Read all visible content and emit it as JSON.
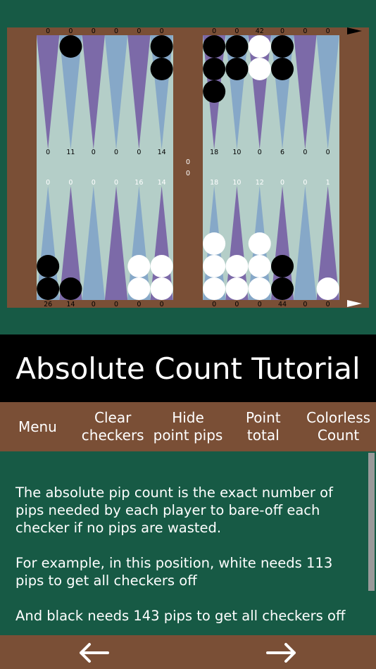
{
  "board": {
    "colors": {
      "frame": "#7a4f36",
      "field": "#b4cec8",
      "point_purple": "#7c6aa8",
      "point_blue": "#86a8c8",
      "checker_black": "#000000",
      "checker_white": "#ffffff",
      "pip_dark": "#000000",
      "pip_light": "#ffffff"
    },
    "top_pips": [
      "0",
      "0",
      "0",
      "0",
      "0",
      "0",
      "0",
      "0",
      "42",
      "0",
      "0",
      "0"
    ],
    "top_counts": [
      "0",
      "11",
      "0",
      "0",
      "0",
      "14",
      "18",
      "10",
      "0",
      "6",
      "0",
      "0"
    ],
    "bottom_pips": [
      "0",
      "0",
      "0",
      "0",
      "16",
      "14",
      "18",
      "10",
      "12",
      "0",
      "0",
      "1"
    ],
    "bottom_counts": [
      "26",
      "14",
      "0",
      "0",
      "0",
      "0",
      "0",
      "0",
      "0",
      "44",
      "0",
      "0"
    ],
    "bar_counts": [
      "0",
      "0"
    ],
    "top_checkers": [
      [],
      [
        "black"
      ],
      [],
      [],
      [],
      [
        "black",
        "black"
      ],
      [
        "black",
        "black",
        "black"
      ],
      [
        "black",
        "black"
      ],
      [
        "white",
        "white"
      ],
      [
        "black",
        "black"
      ],
      [],
      []
    ],
    "bottom_checkers": [
      [
        "black",
        "black"
      ],
      [
        "black"
      ],
      [],
      [],
      [
        "white",
        "white"
      ],
      [
        "white",
        "white"
      ],
      [
        "white",
        "white",
        "white"
      ],
      [
        "white",
        "white"
      ],
      [
        "white",
        "white",
        "white"
      ],
      [
        "black",
        "black"
      ],
      [],
      [
        "white"
      ]
    ],
    "direction_markers": [
      "arrow-black",
      "arrow-white"
    ]
  },
  "title": "Absolute Count Tutorial",
  "menu": [
    {
      "label": "Menu",
      "name": "menu-button"
    },
    {
      "label": "Clear\ncheckers",
      "name": "clear-checkers-button"
    },
    {
      "label": "Hide\npoint pips",
      "name": "hide-point-pips-button"
    },
    {
      "label": "Point\ntotal",
      "name": "point-total-button"
    },
    {
      "label": "Colorless\nCount",
      "name": "colorless-count-button"
    }
  ],
  "content": {
    "paragraphs": [
      "The absolute pip count is the exact number of pips needed by each player to bare-off each checker if no pips are wasted.",
      "For example, in this position, white needs 113 pips to get all checkers off",
      "And black needs 143 pips to get all checkers off"
    ]
  },
  "nav": {
    "prev_icon": "arrow-left-icon",
    "next_icon": "arrow-right-icon",
    "color": "#ffffff"
  }
}
